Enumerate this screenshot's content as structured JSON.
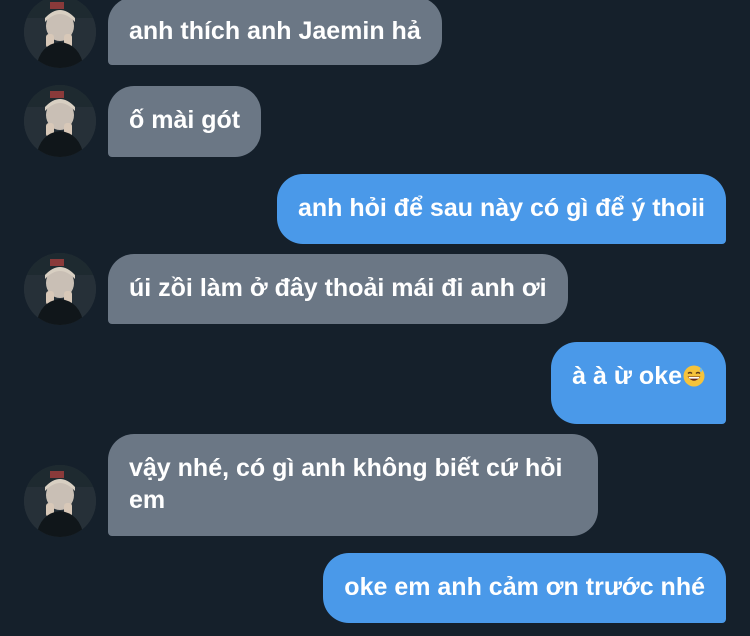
{
  "conversation": {
    "messages": [
      {
        "direction": "in",
        "text": "anh thích anh Jaemin hả"
      },
      {
        "direction": "in",
        "text": "ố mài gót"
      },
      {
        "direction": "out",
        "text": "anh hỏi để sau này có gì để ý thoii"
      },
      {
        "direction": "in",
        "text": "úi zồi làm ở đây thoải mái đi anh ơi"
      },
      {
        "direction": "out",
        "text": "à à ừ oke",
        "emoji": "grinning-sweat-emoji"
      },
      {
        "direction": "in",
        "text": "vậy nhé, có gì anh không biết cứ hỏi em"
      },
      {
        "direction": "out",
        "text": "oke em anh cảm ơn trước nhé"
      }
    ]
  },
  "colors": {
    "background": "#15202b",
    "incoming_bubble": "#6b7785",
    "outgoing_bubble": "#4a99e9",
    "text": "#ffffff"
  }
}
